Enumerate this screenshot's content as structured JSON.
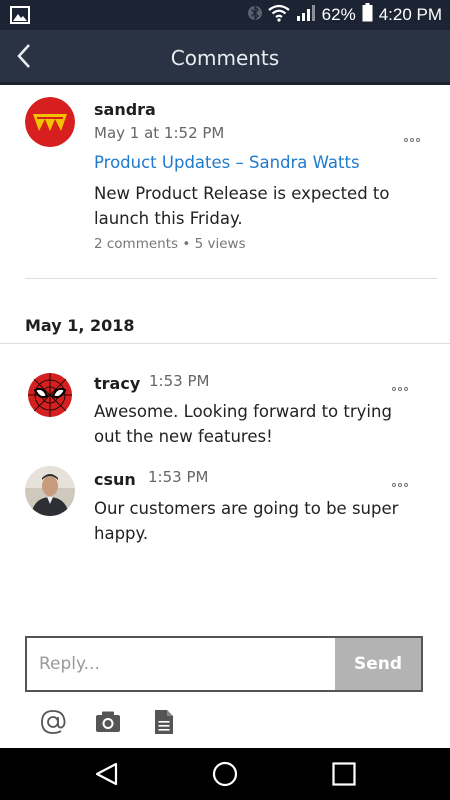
{
  "status_bar": {
    "battery": "62%",
    "time": "4:20 PM"
  },
  "header": {
    "title": "Comments"
  },
  "post": {
    "author": "sandra",
    "timestamp": "May 1 at 1:52 PM",
    "group_link": "Product Updates",
    "separator": "–",
    "person_link": "Sandra Watts",
    "body_line1": "New Product Release is expected to",
    "body_line2": "launch this Friday.",
    "stats": "2 comments • 5 views"
  },
  "date_header": "May 1, 2018",
  "comments": [
    {
      "author": "tracy",
      "time": "1:53 PM",
      "line1": "Awesome. Looking forward to trying",
      "line2": "out the new features!"
    },
    {
      "author": "csun",
      "time": "1:53 PM",
      "line1": "Our customers are going to be super",
      "line2": "happy."
    }
  ],
  "reply": {
    "placeholder": "Reply...",
    "send_label": "Send"
  },
  "colors": {
    "header_bg": "#2a3344",
    "link": "#1f7acc",
    "send_bg": "#b3b3b3"
  },
  "icons": {
    "toolbar": [
      "at-icon",
      "camera-icon",
      "file-icon"
    ],
    "nav": [
      "back-triangle-icon",
      "home-circle-icon",
      "recents-square-icon"
    ]
  }
}
